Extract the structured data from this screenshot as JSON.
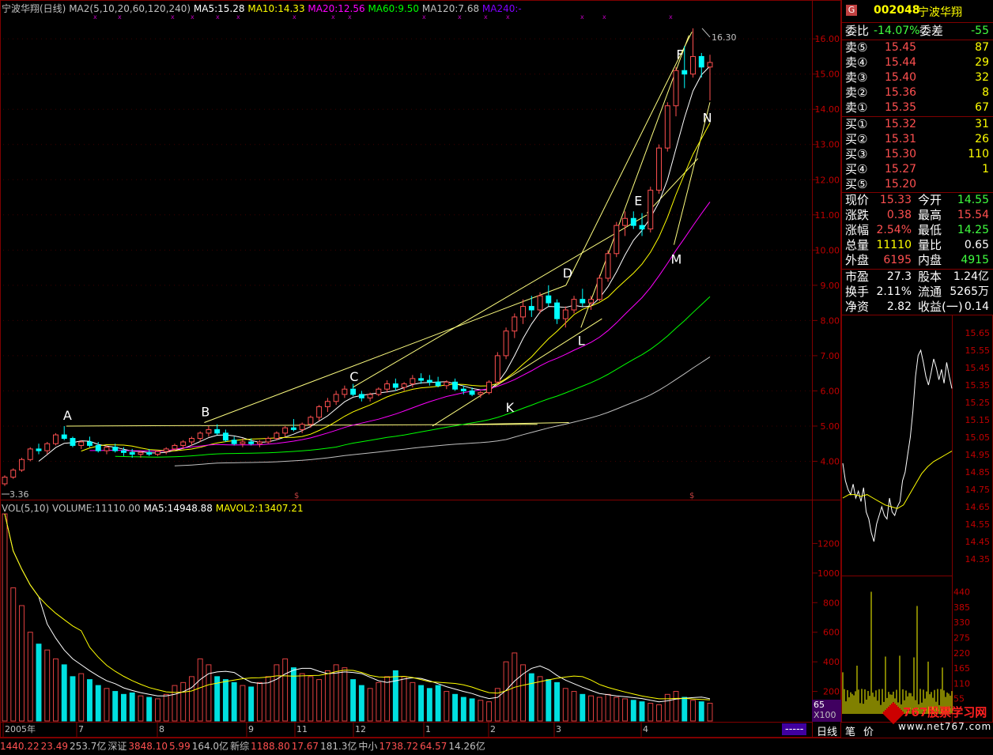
{
  "header": {
    "title": "宁波华翔(日线)",
    "ma_label": "MA2(5,10,20,60,120,240)",
    "ma_values": [
      {
        "label": "MA5:15.28",
        "color": "#ffffff"
      },
      {
        "label": "MA10:14.33",
        "color": "#ffff00"
      },
      {
        "label": "MA20:12.56",
        "color": "#ff00ff"
      },
      {
        "label": "MA60:9.50",
        "color": "#00ff00"
      },
      {
        "label": "MA120:7.68",
        "color": "#c0c0c0"
      },
      {
        "label": "MA240:-",
        "color": "#8000ff"
      }
    ]
  },
  "vol_header": {
    "label": "VOL(5,10)",
    "volume": "VOLUME:11110.00",
    "ma5": "MA5:14948.88",
    "mavol2": "MAVOL2:13407.21"
  },
  "chart_data": [
    {
      "type": "candlestick",
      "title": "宁波华翔(日线)",
      "y_ticks": [
        "16.00",
        "15.00",
        "14.00",
        "13.00",
        "12.00",
        "11.00",
        "10.00",
        "9.00",
        "8.00",
        "7.00",
        "6.00",
        "5.00",
        "4.00"
      ],
      "ylim": [
        3.0,
        16.7
      ],
      "x_ticks": [
        "2005年",
        "7",
        "8",
        "9",
        "11",
        "12",
        "1",
        "2",
        "3",
        "4"
      ],
      "annotations": {
        "high_label": "16.30",
        "low_label": "3.36",
        "points": [
          {
            "name": "A",
            "x": 41,
            "y": 5.0
          },
          {
            "name": "B",
            "x": 133,
            "y": 5.1
          },
          {
            "name": "C",
            "x": 232,
            "y": 6.1
          },
          {
            "name": "K",
            "x": 336,
            "y": 5.85
          },
          {
            "name": "D",
            "x": 374,
            "y": 9.0
          },
          {
            "name": "L",
            "x": 384,
            "y": 7.8
          },
          {
            "name": "E",
            "x": 428,
            "y": 11.05
          },
          {
            "name": "M",
            "x": 446,
            "y": 10.15
          },
          {
            "name": "F",
            "x": 456,
            "y": 15.3
          },
          {
            "name": "N",
            "x": 464,
            "y": 13.9
          }
        ]
      },
      "ohlc": [
        [
          3.36,
          3.6,
          3.3,
          3.55
        ],
        [
          3.55,
          3.8,
          3.5,
          3.75
        ],
        [
          3.75,
          4.1,
          3.7,
          4.05
        ],
        [
          4.05,
          4.4,
          4.0,
          4.35
        ],
        [
          4.35,
          4.5,
          4.2,
          4.3
        ],
        [
          4.3,
          4.55,
          4.2,
          4.5
        ],
        [
          4.5,
          4.8,
          4.45,
          4.75
        ],
        [
          4.75,
          5.0,
          4.6,
          4.65
        ],
        [
          4.65,
          4.7,
          4.4,
          4.45
        ],
        [
          4.45,
          4.6,
          4.35,
          4.55
        ],
        [
          4.55,
          4.7,
          4.4,
          4.45
        ],
        [
          4.45,
          4.55,
          4.25,
          4.3
        ],
        [
          4.3,
          4.45,
          4.2,
          4.4
        ],
        [
          4.4,
          4.5,
          4.25,
          4.3
        ],
        [
          4.3,
          4.4,
          4.15,
          4.25
        ],
        [
          4.25,
          4.35,
          4.1,
          4.2
        ],
        [
          4.2,
          4.3,
          4.1,
          4.25
        ],
        [
          4.25,
          4.35,
          4.15,
          4.2
        ],
        [
          4.2,
          4.3,
          4.15,
          4.28
        ],
        [
          4.28,
          4.4,
          4.2,
          4.35
        ],
        [
          4.35,
          4.5,
          4.3,
          4.45
        ],
        [
          4.45,
          4.6,
          4.35,
          4.55
        ],
        [
          4.55,
          4.7,
          4.45,
          4.65
        ],
        [
          4.65,
          4.85,
          4.55,
          4.8
        ],
        [
          4.8,
          5.0,
          4.7,
          4.9
        ],
        [
          4.9,
          5.05,
          4.75,
          4.8
        ],
        [
          4.8,
          4.9,
          4.55,
          4.6
        ],
        [
          4.6,
          4.7,
          4.45,
          4.5
        ],
        [
          4.5,
          4.65,
          4.4,
          4.55
        ],
        [
          4.55,
          4.65,
          4.45,
          4.5
        ],
        [
          4.5,
          4.6,
          4.4,
          4.55
        ],
        [
          4.55,
          4.7,
          4.5,
          4.65
        ],
        [
          4.65,
          4.85,
          4.6,
          4.8
        ],
        [
          4.8,
          5.0,
          4.7,
          4.95
        ],
        [
          4.95,
          5.2,
          4.85,
          4.9
        ],
        [
          4.9,
          5.1,
          4.8,
          5.05
        ],
        [
          5.05,
          5.3,
          4.95,
          5.25
        ],
        [
          5.25,
          5.6,
          5.15,
          5.55
        ],
        [
          5.55,
          5.8,
          5.4,
          5.7
        ],
        [
          5.7,
          6.0,
          5.6,
          5.9
        ],
        [
          5.9,
          6.15,
          5.8,
          6.05
        ],
        [
          6.05,
          6.2,
          5.85,
          5.9
        ],
        [
          5.9,
          6.0,
          5.7,
          5.8
        ],
        [
          5.8,
          5.95,
          5.7,
          5.9
        ],
        [
          5.9,
          6.1,
          5.85,
          6.05
        ],
        [
          6.05,
          6.3,
          5.95,
          6.2
        ],
        [
          6.2,
          6.35,
          6.0,
          6.1
        ],
        [
          6.1,
          6.25,
          6.0,
          6.2
        ],
        [
          6.2,
          6.45,
          6.1,
          6.35
        ],
        [
          6.35,
          6.5,
          6.2,
          6.3
        ],
        [
          6.3,
          6.45,
          6.15,
          6.25
        ],
        [
          6.25,
          6.4,
          6.1,
          6.15
        ],
        [
          6.15,
          6.3,
          6.05,
          6.25
        ],
        [
          6.25,
          6.35,
          6.0,
          6.05
        ],
        [
          6.05,
          6.15,
          5.9,
          6.0
        ],
        [
          6.0,
          6.1,
          5.85,
          5.9
        ],
        [
          5.9,
          6.0,
          5.8,
          5.95
        ],
        [
          5.95,
          6.3,
          5.9,
          6.25
        ],
        [
          6.25,
          7.1,
          6.2,
          7.0
        ],
        [
          7.0,
          7.8,
          6.9,
          7.7
        ],
        [
          7.7,
          8.2,
          7.5,
          8.1
        ],
        [
          8.1,
          8.6,
          7.9,
          8.4
        ],
        [
          8.4,
          8.7,
          8.1,
          8.3
        ],
        [
          8.3,
          8.8,
          8.2,
          8.7
        ],
        [
          8.7,
          9.0,
          8.4,
          8.5
        ],
        [
          8.5,
          8.6,
          7.9,
          8.05
        ],
        [
          8.05,
          8.4,
          7.8,
          8.3
        ],
        [
          8.3,
          8.7,
          8.2,
          8.6
        ],
        [
          8.6,
          8.9,
          8.4,
          8.5
        ],
        [
          8.5,
          8.7,
          8.3,
          8.6
        ],
        [
          8.6,
          9.3,
          8.55,
          9.2
        ],
        [
          9.2,
          10.0,
          9.1,
          9.9
        ],
        [
          9.9,
          10.8,
          9.8,
          10.7
        ],
        [
          10.7,
          11.1,
          10.4,
          10.9
        ],
        [
          10.9,
          11.1,
          10.6,
          10.7
        ],
        [
          10.7,
          11.05,
          10.4,
          10.6
        ],
        [
          10.6,
          11.8,
          10.5,
          11.7
        ],
        [
          11.7,
          13.0,
          11.6,
          12.9
        ],
        [
          12.9,
          14.2,
          12.8,
          14.1
        ],
        [
          14.1,
          15.2,
          13.8,
          15.1
        ],
        [
          15.1,
          15.8,
          14.6,
          15.0
        ],
        [
          15.0,
          16.3,
          14.9,
          15.5
        ],
        [
          15.5,
          15.6,
          14.9,
          15.2
        ],
        [
          15.2,
          15.55,
          14.25,
          15.33
        ]
      ],
      "ma_series": [
        {
          "name": "MA5",
          "color": "#ffffff"
        },
        {
          "name": "MA10",
          "color": "#ffff00"
        },
        {
          "name": "MA20",
          "color": "#ff00ff"
        },
        {
          "name": "MA60",
          "color": "#00ff00"
        },
        {
          "name": "MA120",
          "color": "#c0c0c0"
        }
      ]
    },
    {
      "type": "bar",
      "title": "VOL(5,10)",
      "y_ticks": [
        "1200",
        "1000",
        "800",
        "600",
        "400",
        "200"
      ],
      "ylim": [
        0,
        1400
      ],
      "unit_label": "X100",
      "left_value": "65",
      "values": [
        1400,
        900,
        780,
        600,
        520,
        480,
        420,
        380,
        300,
        320,
        280,
        240,
        220,
        200,
        180,
        190,
        170,
        160,
        150,
        180,
        240,
        260,
        300,
        420,
        380,
        300,
        280,
        260,
        240,
        230,
        260,
        300,
        380,
        420,
        360,
        320,
        300,
        280,
        340,
        380,
        360,
        280,
        240,
        220,
        260,
        300,
        340,
        300,
        260,
        240,
        220,
        240,
        200,
        180,
        160,
        150,
        140,
        130,
        220,
        400,
        460,
        380,
        320,
        300,
        280,
        260,
        220,
        200,
        180,
        170,
        160,
        180,
        160,
        150,
        140,
        130,
        120,
        110,
        180,
        200,
        160,
        140,
        130,
        120
      ]
    },
    {
      "type": "line",
      "title": "intraday",
      "y_ticks": [
        "15.65",
        "15.55",
        "15.45",
        "15.35",
        "15.25",
        "15.15",
        "15.05",
        "14.95",
        "14.85",
        "14.75",
        "14.65",
        "14.55",
        "14.45",
        "14.35"
      ],
      "ylim": [
        14.3,
        15.7
      ],
      "vol_ticks": [
        "440",
        "385",
        "330",
        "275",
        "220",
        "165",
        "110",
        "55"
      ]
    }
  ],
  "panel": {
    "code": "002048",
    "name": "宁波华翔",
    "g_icon": "G",
    "weibi_label": "委比",
    "weibi_value": "-14.07%",
    "weicha_label": "委差",
    "weicha_value": "-55",
    "sell": [
      {
        "label": "卖⑤",
        "price": "15.45",
        "vol": "87"
      },
      {
        "label": "卖④",
        "price": "15.44",
        "vol": "29"
      },
      {
        "label": "卖③",
        "price": "15.40",
        "vol": "32"
      },
      {
        "label": "卖②",
        "price": "15.36",
        "vol": "8"
      },
      {
        "label": "卖①",
        "price": "15.35",
        "vol": "67"
      }
    ],
    "buy": [
      {
        "label": "买①",
        "price": "15.32",
        "vol": "31"
      },
      {
        "label": "买②",
        "price": "15.31",
        "vol": "26"
      },
      {
        "label": "买③",
        "price": "15.30",
        "vol": "110"
      },
      {
        "label": "买④",
        "price": "15.27",
        "vol": "1"
      },
      {
        "label": "买⑤",
        "price": "15.20",
        "vol": ""
      }
    ],
    "stats": [
      {
        "l1": "现价",
        "v1": "15.33",
        "c1": "red",
        "l2": "今开",
        "v2": "14.55",
        "c2": "grn"
      },
      {
        "l1": "涨跌",
        "v1": "0.38",
        "c1": "red",
        "l2": "最高",
        "v2": "15.54",
        "c2": "red"
      },
      {
        "l1": "涨幅",
        "v1": "2.54%",
        "c1": "red",
        "l2": "最低",
        "v2": "14.25",
        "c2": "grn"
      },
      {
        "l1": "总量",
        "v1": "11110",
        "c1": "yel",
        "l2": "量比",
        "v2": "0.65",
        "c2": "wht"
      },
      {
        "l1": "外盘",
        "v1": "6195",
        "c1": "red",
        "l2": "内盘",
        "v2": "4915",
        "c2": "grn"
      }
    ],
    "fund": [
      {
        "l1": "市盈",
        "v1": "27.3",
        "l2": "股本",
        "v2": "1.24亿"
      },
      {
        "l1": "换手",
        "v1": "2.11%",
        "l2": "流通",
        "v2": "5265万"
      },
      {
        "l1": "净资",
        "v1": "2.82",
        "l2": "收益(一)",
        "v2": "0.14"
      }
    ]
  },
  "tabs": {
    "daily": "日线",
    "tick": "笔",
    "price": "价",
    "dash": "-----"
  },
  "watermark": {
    "line1": "767股票学习网",
    "line2": "www.net767.com"
  },
  "bottombar": {
    "items": [
      {
        "v": "1440.22",
        "c": "#ff5050"
      },
      {
        "v": "23.49",
        "c": "#ff5050"
      },
      {
        "v": "253.7亿",
        "c": "#c0c0c0"
      },
      {
        "v": "深证",
        "c": "#c0c0c0"
      },
      {
        "v": "3848.10",
        "c": "#ff5050"
      },
      {
        "v": "5.99",
        "c": "#ff5050"
      },
      {
        "v": "164.0亿",
        "c": "#c0c0c0"
      },
      {
        "v": "新综",
        "c": "#c0c0c0"
      },
      {
        "v": "1188.80",
        "c": "#ff5050"
      },
      {
        "v": "17.67",
        "c": "#ff5050"
      },
      {
        "v": "181.3亿",
        "c": "#c0c0c0"
      },
      {
        "v": "中小",
        "c": "#c0c0c0"
      },
      {
        "v": "1738.72",
        "c": "#ff5050"
      },
      {
        "v": "64.57",
        "c": "#ff5050"
      },
      {
        "v": "14.26亿",
        "c": "#c0c0c0"
      }
    ]
  }
}
